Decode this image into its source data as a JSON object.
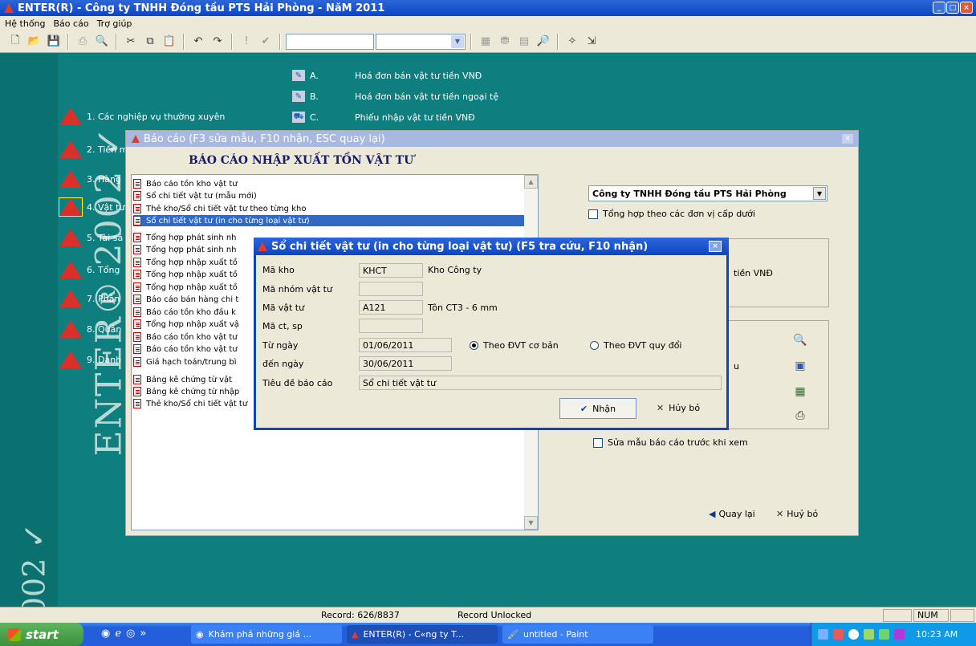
{
  "window": {
    "title": "ENTER(R) - Công ty TNHH Đóng tầu PTS Hải Phòng - NăM 2011",
    "buttons": [
      "minimize",
      "maximize",
      "close"
    ]
  },
  "menu": [
    "Hệ thống",
    "Báo cáo",
    "Trợ giúp"
  ],
  "toolbar": {
    "icons": [
      "new-icon",
      "open-icon",
      "save-icon",
      "print-icon",
      "preview-icon",
      "cut-icon",
      "copy-icon",
      "paste-icon",
      "undo-icon",
      "redo-icon",
      "exclamation-icon",
      "check-icon"
    ],
    "combo_value": ""
  },
  "background": {
    "brand": "ENTER® 2002 ✓",
    "brand_bottom": "2002 ✓",
    "main_items": [
      {
        "label": "1. Các nghiệp vụ thường xuyên"
      },
      {
        "label": "2. Tiền m"
      },
      {
        "label": "3. Hàng"
      },
      {
        "label": "4. Vật tư"
      },
      {
        "label": "5. Tài sả"
      },
      {
        "label": "6. Tổng"
      },
      {
        "label": "7. Phân"
      },
      {
        "label": "8. Quản"
      },
      {
        "label": "9. Danh"
      }
    ],
    "sub_items": [
      {
        "key": "A.",
        "label": "Hoá đơn bán vật tư tiền VNĐ"
      },
      {
        "key": "B.",
        "label": "Hoá đơn bán vật tư tiền ngoại tệ"
      },
      {
        "key": "C.",
        "label": "Phiếu nhập vật tư tiền VNĐ"
      }
    ]
  },
  "report_dialog": {
    "caption": "Báo cáo (F3 sửa mẫu, F10 nhận, ESC quay lại)",
    "heading": "BÁO CÁO NHẬP XUẤT TỒN VẬT TƯ",
    "list": [
      "Báo cáo tồn kho vật tư",
      "Sổ chi tiết vật tư (mẫu mới)",
      "Thẻ kho/Sổ chi tiết vật tư theo từng kho",
      "Sổ chi tiết vật tư (in cho từng loại vật tư)",
      "Tổng hợp phát sinh nh",
      "Tổng hợp phát sinh nh",
      "Tổng hợp nhập xuất tồ",
      "Tổng hợp nhập xuất tồ",
      "Tổng hợp nhập xuất tồ",
      "Báo cáo bán hàng chi t",
      "Báo cáo tồn kho đầu k",
      "Tổng hợp nhập xuất vậ",
      "Báo cáo tồn kho vật tư",
      "Báo cáo tồn kho vật tư",
      "Giá hạch toán/trung bì",
      "Bảng kê chứng từ vật",
      "Bảng kê chứng từ nhập",
      "Thẻ kho/Sổ chi tiết vật tư"
    ],
    "selected_index": 3,
    "company_combo": "Công ty TNHH Đóng tầu PTS Hải Phòng",
    "summary_check": "Tổng hợp theo các đơn vị cấp dưới",
    "partial_text_1": "tiền VNĐ",
    "partial_text_2": "u",
    "edit_template_check": "Sửa mẫu báo cáo trước khi xem",
    "back_button": "Quay lại",
    "cancel_button": "Huỷ bỏ"
  },
  "detail_dialog": {
    "caption": "Sổ chi tiết vật tư (in cho từng loại vật tư) (F5 tra cứu, F10 nhận)",
    "fields": {
      "warehouse_code_label": "Mã kho",
      "warehouse_code": "KHCT",
      "warehouse_name": "Kho Công ty",
      "group_code_label": "Mã nhóm vật tư",
      "group_code": "",
      "item_code_label": "Mã vật tư",
      "item_code": "A121",
      "item_name": "Tôn CT3 - 6 mm",
      "product_code_label": "Mã ct, sp",
      "product_code": "",
      "from_label": "Từ ngày",
      "from_date": "01/06/2011",
      "to_label": "đến ngày",
      "to_date": "30/06/2011",
      "title_label": "Tiêu đề báo cáo",
      "title_value": "Sổ chi tiết vật tư"
    },
    "unit_options": {
      "basic": "Theo ĐVT cơ bản",
      "converted": "Theo ĐVT quy đổi",
      "selected": "basic"
    },
    "ok_button": "Nhận",
    "cancel_button": "Hủy bỏ"
  },
  "status_bar": {
    "record": "Record: 626/8837",
    "lock": "Record Unlocked",
    "num": "NUM"
  },
  "taskbar": {
    "start": "start",
    "tasks": [
      "Khám phá những giá ...",
      "ENTER(R) - C«ng ty T...",
      "untitled - Paint"
    ],
    "clock": "10:23 AM"
  },
  "colors": {
    "workspace": "#0f7e7e",
    "titlebar": "#0b46c4",
    "selection": "#316ac5"
  }
}
